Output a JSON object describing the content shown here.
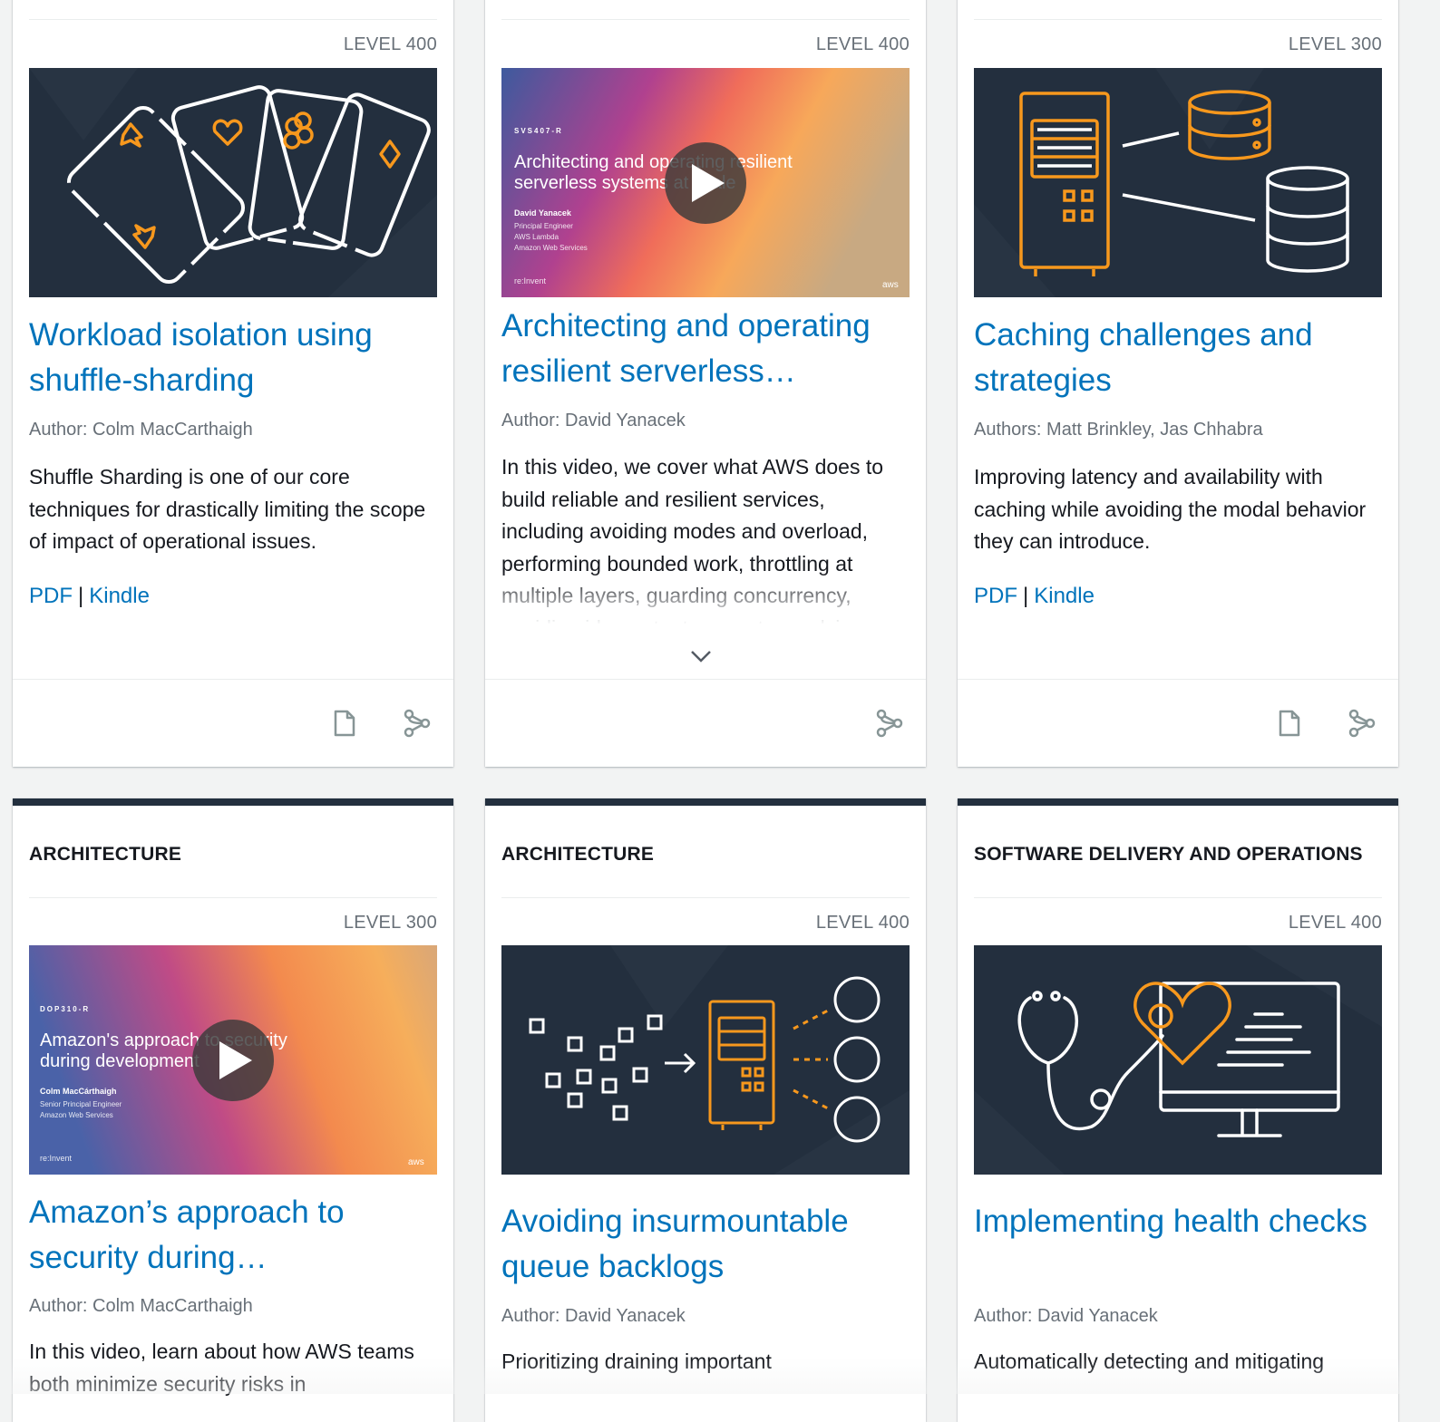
{
  "colors": {
    "link": "#0073bb",
    "dark_navy": "#232f3e",
    "orange_accent": "#f7981d",
    "muted": "#687078"
  },
  "cards": [
    {
      "level": "LEVEL 400",
      "thumbnail_icon": "playing-cards-illustration",
      "title": "Workload isolation using shuffle-sharding",
      "author": "Author: Colm MacCarthaigh",
      "description": "Shuffle Sharding is one of our core techniques for drastically limiting the scope of impact of operational issues.",
      "links": {
        "pdf": "PDF",
        "separator": "|",
        "kindle": "Kindle"
      },
      "footer_icons": [
        "document-icon",
        "share-icon"
      ]
    },
    {
      "level": "LEVEL 400",
      "thumbnail_icon": "video-thumbnail",
      "video": {
        "code": "SVS407-R",
        "title_line1": "Architecting and operating resilient",
        "title_line2": "serverless systems at scale",
        "presenter": "David Yanacek",
        "role1": "Principal Engineer",
        "role2": "AWS Lambda",
        "role3": "Amazon Web Services",
        "brand": "re:Invent",
        "logo": "aws"
      },
      "title": "Architecting and operating resilient serverless…",
      "author": "Author: David Yanacek",
      "description": "In this video, we cover what AWS does to build reliable and resilient services, including avoiding modes and overload, performing bounded work, throttling at multiple layers, guarding concurrency, avoiding idempotent requests, applying",
      "footer_icons": [
        "share-icon"
      ]
    },
    {
      "level": "LEVEL 300",
      "thumbnail_icon": "server-and-databases-illustration",
      "title": "Caching challenges and strategies",
      "author": "Authors: Matt Brinkley, Jas Chhabra",
      "description": "Improving latency and availability with caching while avoiding the modal behavior they can introduce.",
      "links": {
        "pdf": "PDF",
        "separator": "|",
        "kindle": "Kindle"
      },
      "footer_icons": [
        "document-icon",
        "share-icon"
      ]
    },
    {
      "category": "ARCHITECTURE",
      "level": "LEVEL 300",
      "thumbnail_icon": "video-thumbnail",
      "video": {
        "code": "DOP310-R",
        "title_line1": "Amazon's approach to security",
        "title_line2": "during development",
        "presenter": "Colm MacCárthaigh",
        "role1": "Senior Principal Engineer",
        "role2": "Amazon Web Services",
        "brand": "re:Invent",
        "logo": "aws"
      },
      "title": "Amazon’s approach to security during…",
      "author": "Author: Colm MacCarthaigh",
      "description": "In this video, learn about how AWS teams both minimize security risks in"
    },
    {
      "category": "ARCHITECTURE",
      "level": "LEVEL 400",
      "thumbnail_icon": "queue-to-server-illustration",
      "title": "Avoiding insurmountable queue backlogs",
      "author": "Author: David Yanacek",
      "description": "Prioritizing draining important"
    },
    {
      "category": "SOFTWARE DELIVERY AND OPERATIONS",
      "level": "LEVEL 400",
      "thumbnail_icon": "stethoscope-heart-monitor-illustration",
      "title": "Implementing health checks",
      "author": "Author: David Yanacek",
      "description": "Automatically detecting and mitigating"
    }
  ]
}
